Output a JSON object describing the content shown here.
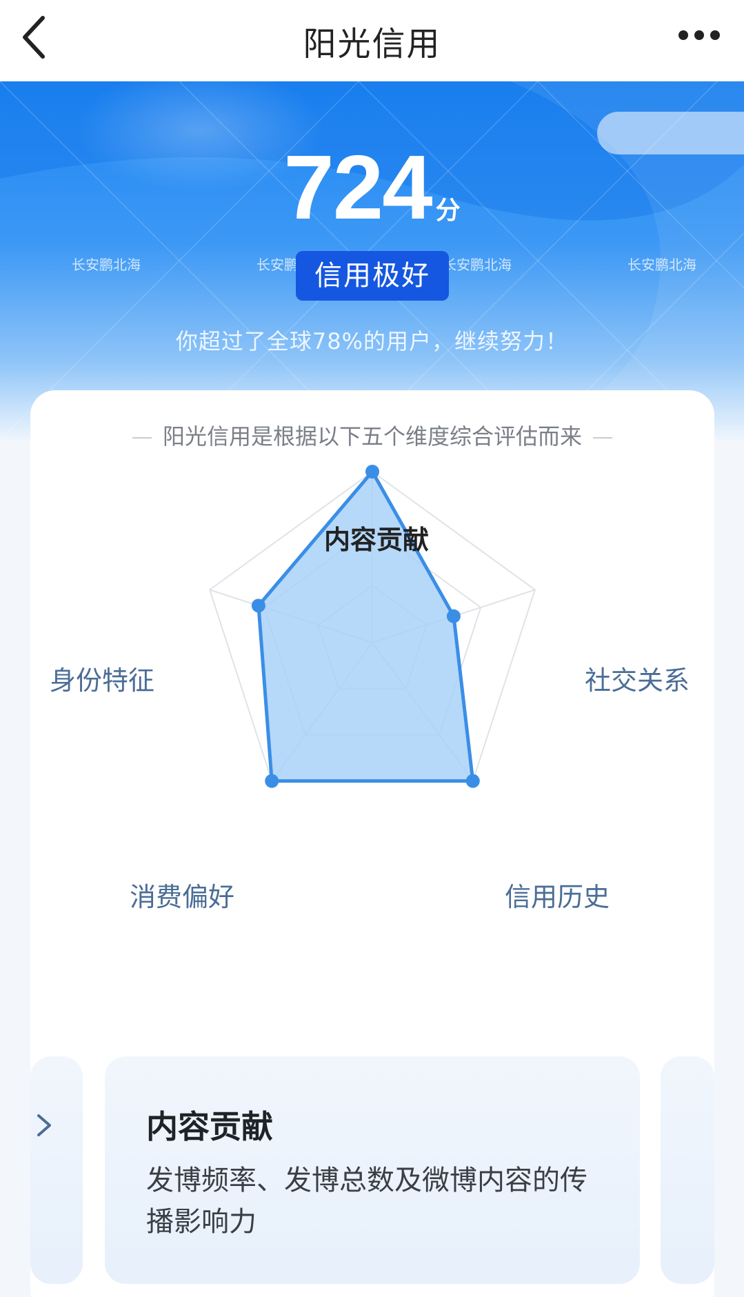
{
  "header": {
    "title": "阳光信用",
    "back_icon": "chevron-left-icon",
    "more_icon": "more-horizontal-icon"
  },
  "hero": {
    "score": "724",
    "score_unit": "分",
    "level": "信用极好",
    "subtitle": "你超过了全球78%的用户，继续努力！",
    "watermark": "长安鹏北海"
  },
  "card": {
    "caption": "阳光信用是根据以下五个维度综合评估而来"
  },
  "radar": {
    "dimensions": [
      "内容贡献",
      "社交关系",
      "信用历史",
      "消费偏好",
      "身份特征"
    ],
    "active_dimension": "内容贡献",
    "values": [
      1.0,
      0.5,
      1.0,
      1.0,
      0.7
    ],
    "colors": {
      "stroke": "#3a8ee6",
      "fill": "#a9d1f8",
      "grid": "#dfe3e8",
      "label": "#4a6d95",
      "label_active": "#222222"
    }
  },
  "dimension_cards": [
    {
      "title": "内容贡献",
      "description": "发博频率、发博总数及微博内容的传播影响力"
    }
  ],
  "colors": {
    "brand_blue": "#1f86f3",
    "badge_blue": "#1557e0"
  }
}
